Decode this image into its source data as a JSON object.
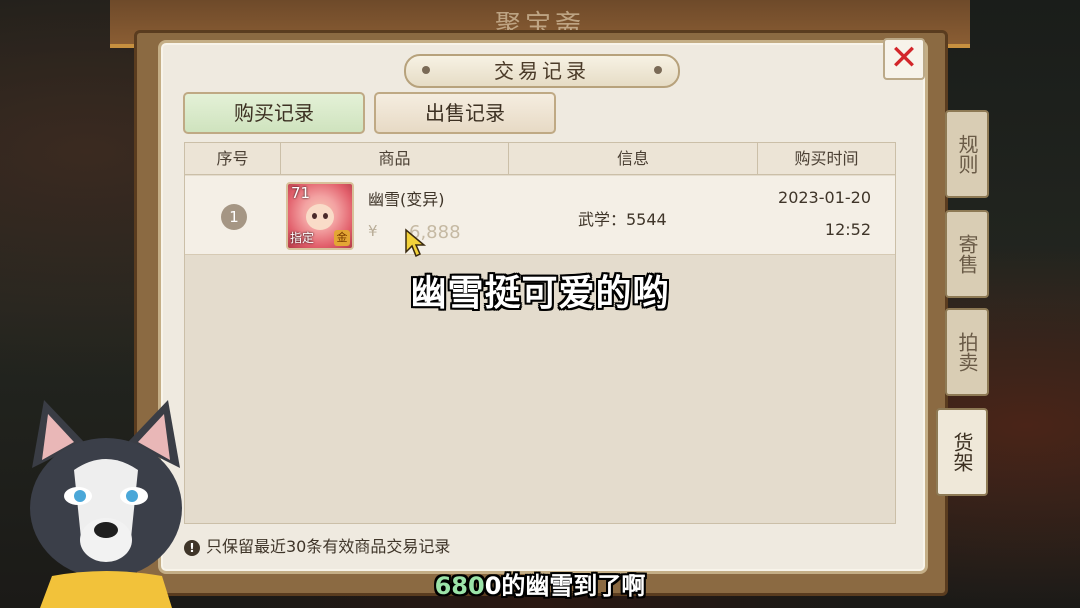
{
  "background": {
    "top_title": "聚宝斋"
  },
  "dialog": {
    "title": "交易记录",
    "close_icon": "close-x-icon",
    "tabs": [
      {
        "label": "购买记录",
        "active": true
      },
      {
        "label": "出售记录",
        "active": false
      }
    ],
    "table": {
      "headers": [
        "序号",
        "商品",
        "信息",
        "购买时间"
      ],
      "rows": [
        {
          "index": "1",
          "item_name": "幽雪(变异)",
          "avatar_level": "71",
          "avatar_tag_left": "指定",
          "avatar_tag_right": "金",
          "currency_symbol": "¥",
          "price": "6,888",
          "info": "武学：5544",
          "date": "2023-01-20",
          "time": "12:52"
        }
      ]
    },
    "note_icon": "!",
    "note": "只保留最近30条有效商品交易记录"
  },
  "side_tabs": [
    {
      "label": "规则",
      "active": false
    },
    {
      "label": "寄售",
      "active": false
    },
    {
      "label": "拍卖",
      "active": false
    },
    {
      "label": "货架",
      "active": true
    }
  ],
  "subtitles": {
    "line1": "幽雪挺可爱的哟",
    "line2_highlight": "680",
    "line2_rest": "0的幽雪到了啊"
  },
  "colors": {
    "buy_tab_bg": "#d7e9c6",
    "close_x": "#d3262a",
    "subtitle_highlight": "#9be3a8"
  }
}
